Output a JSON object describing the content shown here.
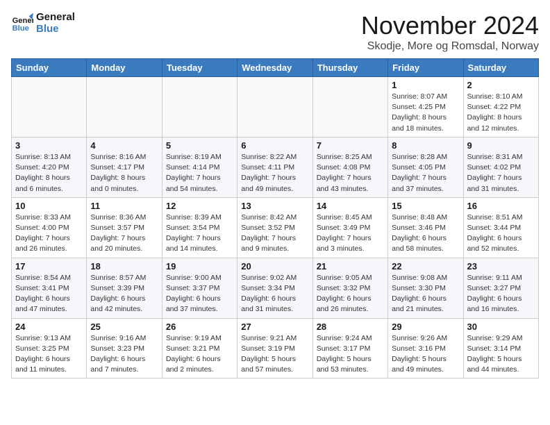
{
  "logo": {
    "line1": "General",
    "line2": "Blue"
  },
  "title": "November 2024",
  "subtitle": "Skodje, More og Romsdal, Norway",
  "headers": [
    "Sunday",
    "Monday",
    "Tuesday",
    "Wednesday",
    "Thursday",
    "Friday",
    "Saturday"
  ],
  "weeks": [
    [
      {
        "day": "",
        "info": ""
      },
      {
        "day": "",
        "info": ""
      },
      {
        "day": "",
        "info": ""
      },
      {
        "day": "",
        "info": ""
      },
      {
        "day": "",
        "info": ""
      },
      {
        "day": "1",
        "info": "Sunrise: 8:07 AM\nSunset: 4:25 PM\nDaylight: 8 hours\nand 18 minutes."
      },
      {
        "day": "2",
        "info": "Sunrise: 8:10 AM\nSunset: 4:22 PM\nDaylight: 8 hours\nand 12 minutes."
      }
    ],
    [
      {
        "day": "3",
        "info": "Sunrise: 8:13 AM\nSunset: 4:20 PM\nDaylight: 8 hours\nand 6 minutes."
      },
      {
        "day": "4",
        "info": "Sunrise: 8:16 AM\nSunset: 4:17 PM\nDaylight: 8 hours\nand 0 minutes."
      },
      {
        "day": "5",
        "info": "Sunrise: 8:19 AM\nSunset: 4:14 PM\nDaylight: 7 hours\nand 54 minutes."
      },
      {
        "day": "6",
        "info": "Sunrise: 8:22 AM\nSunset: 4:11 PM\nDaylight: 7 hours\nand 49 minutes."
      },
      {
        "day": "7",
        "info": "Sunrise: 8:25 AM\nSunset: 4:08 PM\nDaylight: 7 hours\nand 43 minutes."
      },
      {
        "day": "8",
        "info": "Sunrise: 8:28 AM\nSunset: 4:05 PM\nDaylight: 7 hours\nand 37 minutes."
      },
      {
        "day": "9",
        "info": "Sunrise: 8:31 AM\nSunset: 4:02 PM\nDaylight: 7 hours\nand 31 minutes."
      }
    ],
    [
      {
        "day": "10",
        "info": "Sunrise: 8:33 AM\nSunset: 4:00 PM\nDaylight: 7 hours\nand 26 minutes."
      },
      {
        "day": "11",
        "info": "Sunrise: 8:36 AM\nSunset: 3:57 PM\nDaylight: 7 hours\nand 20 minutes."
      },
      {
        "day": "12",
        "info": "Sunrise: 8:39 AM\nSunset: 3:54 PM\nDaylight: 7 hours\nand 14 minutes."
      },
      {
        "day": "13",
        "info": "Sunrise: 8:42 AM\nSunset: 3:52 PM\nDaylight: 7 hours\nand 9 minutes."
      },
      {
        "day": "14",
        "info": "Sunrise: 8:45 AM\nSunset: 3:49 PM\nDaylight: 7 hours\nand 3 minutes."
      },
      {
        "day": "15",
        "info": "Sunrise: 8:48 AM\nSunset: 3:46 PM\nDaylight: 6 hours\nand 58 minutes."
      },
      {
        "day": "16",
        "info": "Sunrise: 8:51 AM\nSunset: 3:44 PM\nDaylight: 6 hours\nand 52 minutes."
      }
    ],
    [
      {
        "day": "17",
        "info": "Sunrise: 8:54 AM\nSunset: 3:41 PM\nDaylight: 6 hours\nand 47 minutes."
      },
      {
        "day": "18",
        "info": "Sunrise: 8:57 AM\nSunset: 3:39 PM\nDaylight: 6 hours\nand 42 minutes."
      },
      {
        "day": "19",
        "info": "Sunrise: 9:00 AM\nSunset: 3:37 PM\nDaylight: 6 hours\nand 37 minutes."
      },
      {
        "day": "20",
        "info": "Sunrise: 9:02 AM\nSunset: 3:34 PM\nDaylight: 6 hours\nand 31 minutes."
      },
      {
        "day": "21",
        "info": "Sunrise: 9:05 AM\nSunset: 3:32 PM\nDaylight: 6 hours\nand 26 minutes."
      },
      {
        "day": "22",
        "info": "Sunrise: 9:08 AM\nSunset: 3:30 PM\nDaylight: 6 hours\nand 21 minutes."
      },
      {
        "day": "23",
        "info": "Sunrise: 9:11 AM\nSunset: 3:27 PM\nDaylight: 6 hours\nand 16 minutes."
      }
    ],
    [
      {
        "day": "24",
        "info": "Sunrise: 9:13 AM\nSunset: 3:25 PM\nDaylight: 6 hours\nand 11 minutes."
      },
      {
        "day": "25",
        "info": "Sunrise: 9:16 AM\nSunset: 3:23 PM\nDaylight: 6 hours\nand 7 minutes."
      },
      {
        "day": "26",
        "info": "Sunrise: 9:19 AM\nSunset: 3:21 PM\nDaylight: 6 hours\nand 2 minutes."
      },
      {
        "day": "27",
        "info": "Sunrise: 9:21 AM\nSunset: 3:19 PM\nDaylight: 5 hours\nand 57 minutes."
      },
      {
        "day": "28",
        "info": "Sunrise: 9:24 AM\nSunset: 3:17 PM\nDaylight: 5 hours\nand 53 minutes."
      },
      {
        "day": "29",
        "info": "Sunrise: 9:26 AM\nSunset: 3:16 PM\nDaylight: 5 hours\nand 49 minutes."
      },
      {
        "day": "30",
        "info": "Sunrise: 9:29 AM\nSunset: 3:14 PM\nDaylight: 5 hours\nand 44 minutes."
      }
    ]
  ]
}
